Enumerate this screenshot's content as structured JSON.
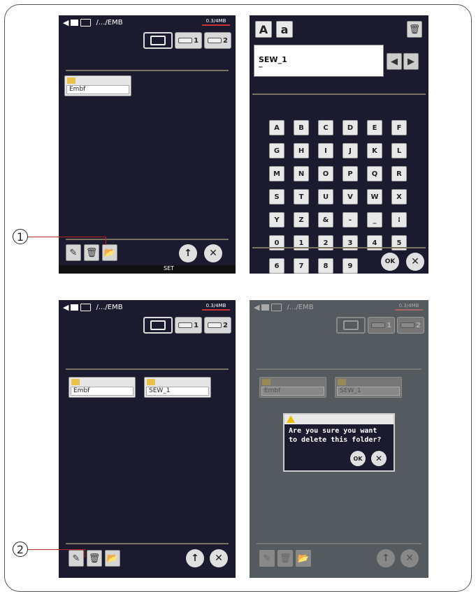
{
  "panel1": {
    "path": "/.../EMB",
    "memory": "0.3/4MB",
    "tab_usb1": "1",
    "tab_usb2": "2",
    "folders": [
      "Embf"
    ],
    "callout": "1",
    "statusbar_set": "SET"
  },
  "panel2": {
    "upper_label": "A",
    "lower_label": "a",
    "input_value": "SEW_1",
    "cursor": "_",
    "keys": [
      "A",
      "B",
      "C",
      "D",
      "E",
      "F",
      "G",
      "H",
      "I",
      "J",
      "K",
      "L",
      "M",
      "N",
      "O",
      "P",
      "Q",
      "R",
      "S",
      "T",
      "U",
      "V",
      "W",
      "X",
      "Y",
      "Z",
      "&",
      "-",
      "_",
      "⁞",
      "0",
      "1",
      "2",
      "3",
      "4",
      "5",
      "6",
      "7",
      "8",
      "9"
    ],
    "ok": "OK"
  },
  "panel3": {
    "path": "/.../EMB",
    "memory": "0.3/4MB",
    "tab_usb1": "1",
    "tab_usb2": "2",
    "folders": [
      "Embf",
      "SEW_1"
    ],
    "callout": "2"
  },
  "panel4": {
    "path": "/.../EMB",
    "memory": "0.3/4MB",
    "tab_usb1": "1",
    "tab_usb2": "2",
    "folders": [
      "Embf",
      "SEW_1"
    ],
    "dialog_line1": "Are you sure you want",
    "dialog_line2": "to delete this folder?",
    "ok": "OK"
  },
  "colors": {
    "screen_bg": "#1b1a2e",
    "greyed_bg": "#555a5f",
    "folder_yellow": "#e8c24a",
    "callout_line": "#b22222"
  }
}
